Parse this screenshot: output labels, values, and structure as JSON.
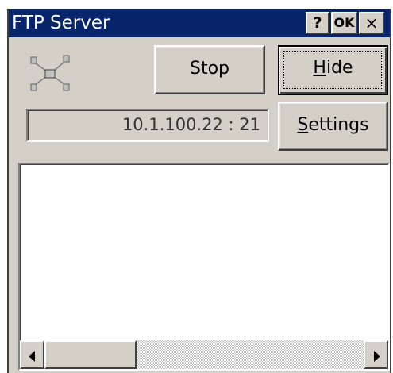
{
  "window": {
    "title": "FTP Server",
    "help_label": "?",
    "ok_label": "OK",
    "close_label": "×"
  },
  "toolbar": {
    "stop_label": "Stop",
    "hide_label_underlined": "H",
    "hide_label_rest": "ide",
    "settings_label_underlined": "S",
    "settings_label_rest": "ettings"
  },
  "status": {
    "address": "10.1.100.22 : 21"
  },
  "log": {
    "entries": []
  },
  "scrollbar": {
    "left_icon": "arrow-left",
    "right_icon": "arrow-right",
    "position": 0
  },
  "icons": {
    "network": "network-status-icon"
  }
}
